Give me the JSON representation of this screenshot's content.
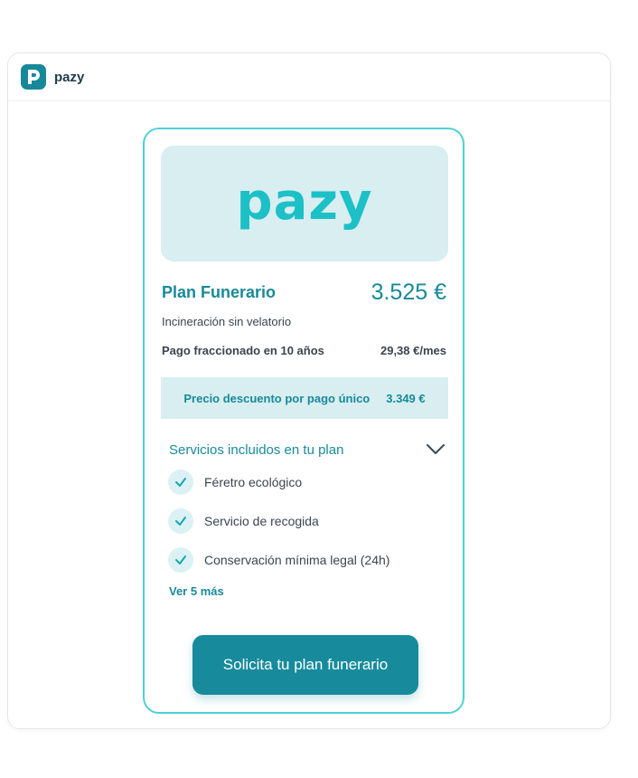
{
  "app": {
    "name": "pazy",
    "logo_letter": "p"
  },
  "hero": {
    "logo_text": "pazy"
  },
  "plan": {
    "title": "Plan Funerario",
    "price": "3.525 €",
    "subtitle": "Incineración sin velatorio",
    "installment_label": "Pago fraccionado en 10 años",
    "installment_value": "29,38 €/mes"
  },
  "discount": {
    "label": "Precio descuento por pago único",
    "value": "3.349 €"
  },
  "services": {
    "title": "Servicios incluidos en tu plan",
    "items": [
      {
        "label": "Féretro ecológico"
      },
      {
        "label": "Servicio de recogida"
      },
      {
        "label": "Conservación mínima legal (24h)"
      }
    ],
    "more_link": "Ver 5 más"
  },
  "cta": {
    "label": "Solicita tu plan funerario"
  },
  "colors": {
    "brand": "#178b9c",
    "accent": "#1cc0c6",
    "card_border": "#4fd0d6",
    "tint": "#d8eef0"
  },
  "icons": {
    "check": "check-icon",
    "chevron": "chevron-down-icon",
    "app_logo": "pazy-logo-icon"
  }
}
